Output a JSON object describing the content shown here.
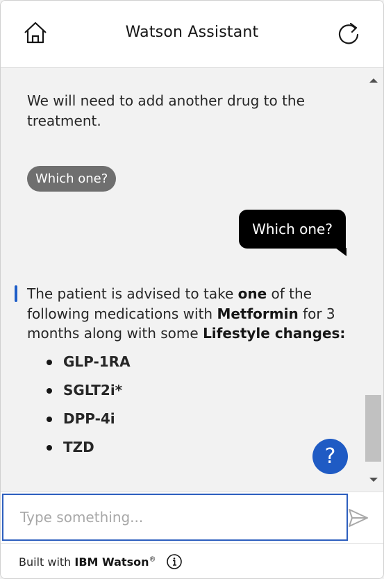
{
  "header": {
    "title": "Watson Assistant",
    "home_icon": "home-icon",
    "restart_icon": "restart-icon"
  },
  "messages": {
    "bot_message_1": "We will need to add another drug to the treatment.",
    "quick_reply": "Which one?",
    "user_message": "Which one?",
    "bot_message_2": {
      "part1": "The patient is advised to take ",
      "bold1": "one",
      "part2": " of the following medications with ",
      "bold2": "Metformin",
      "part3": " for 3 months along with some ",
      "bold3": "Lifestyle changes:"
    },
    "medications": [
      "GLP-1RA",
      "SGLT2i*",
      "DPP-4i",
      "TZD"
    ]
  },
  "help_button": {
    "label": "?"
  },
  "input": {
    "placeholder": "Type something..."
  },
  "footer": {
    "prefix": "Built with ",
    "brand": "IBM Watson",
    "registered": "®"
  },
  "colors": {
    "accent": "#1f5bc4",
    "user_bubble": "#000000",
    "quick_reply": "#6f6f6f",
    "background": "#f2f2f2"
  }
}
